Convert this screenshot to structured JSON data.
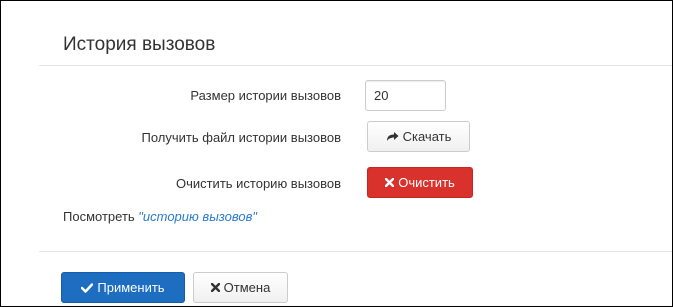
{
  "section": {
    "title": "История вызовов"
  },
  "history_size": {
    "label": "Размер истории вызовов",
    "value": "20"
  },
  "download": {
    "label": "Получить файл истории вызовов",
    "button_label": "Скачать",
    "icon": "share-arrow-icon"
  },
  "clear": {
    "label": "Очистить историю вызовов",
    "button_label": "Очистить",
    "icon": "close-icon",
    "color": "#d9322c"
  },
  "view": {
    "prefix": "Посмотреть",
    "link_text": "\"историю вызовов\"",
    "link_color": "#2a7bd1"
  },
  "footer": {
    "apply_label": "Применить",
    "apply_icon": "check-icon",
    "apply_color": "#1d6ec0",
    "cancel_label": "Отмена",
    "cancel_icon": "close-icon"
  }
}
